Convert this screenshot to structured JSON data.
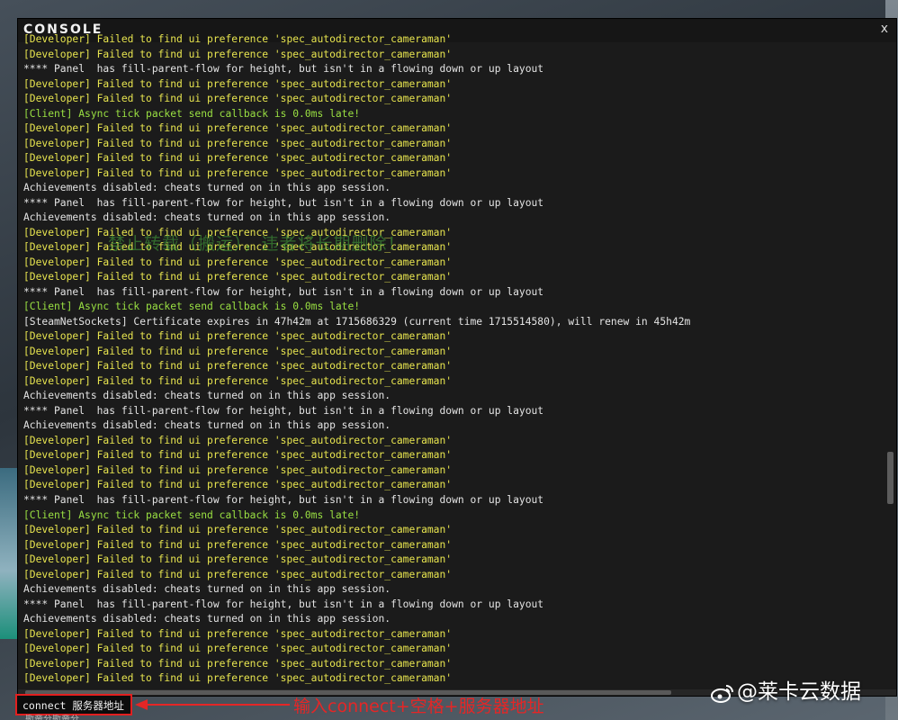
{
  "console": {
    "title": "CONSOLE",
    "close_label": "x",
    "log_lines": [
      {
        "text": "[Developer] Failed to find ui preference 'spec_autodirector_cameraman'",
        "kind": "dev"
      },
      {
        "text": "[Developer] Failed to find ui preference 'spec_autodirector_cameraman'",
        "kind": "dev"
      },
      {
        "text": "**** Panel  has fill-parent-flow for height, but isn't in a flowing down or up layout",
        "kind": "info"
      },
      {
        "text": "[Developer] Failed to find ui preference 'spec_autodirector_cameraman'",
        "kind": "dev"
      },
      {
        "text": "[Developer] Failed to find ui preference 'spec_autodirector_cameraman'",
        "kind": "dev"
      },
      {
        "text": "[Client] Async tick packet send callback is 0.0ms late!",
        "kind": "client"
      },
      {
        "text": "[Developer] Failed to find ui preference 'spec_autodirector_cameraman'",
        "kind": "dev"
      },
      {
        "text": "[Developer] Failed to find ui preference 'spec_autodirector_cameraman'",
        "kind": "dev"
      },
      {
        "text": "[Developer] Failed to find ui preference 'spec_autodirector_cameraman'",
        "kind": "dev"
      },
      {
        "text": "[Developer] Failed to find ui preference 'spec_autodirector_cameraman'",
        "kind": "dev"
      },
      {
        "text": "Achievements disabled: cheats turned on in this app session.",
        "kind": "info"
      },
      {
        "text": "**** Panel  has fill-parent-flow for height, but isn't in a flowing down or up layout",
        "kind": "info"
      },
      {
        "text": "Achievements disabled: cheats turned on in this app session.",
        "kind": "info"
      },
      {
        "text": "[Developer] Failed to find ui preference 'spec_autodirector_cameraman'",
        "kind": "dev"
      },
      {
        "text": "[Developer] Failed to find ui preference 'spec_autodirector_cameraman'",
        "kind": "dev"
      },
      {
        "text": "[Developer] Failed to find ui preference 'spec_autodirector_cameraman'",
        "kind": "dev"
      },
      {
        "text": "[Developer] Failed to find ui preference 'spec_autodirector_cameraman'",
        "kind": "dev"
      },
      {
        "text": "**** Panel  has fill-parent-flow for height, but isn't in a flowing down or up layout",
        "kind": "info"
      },
      {
        "text": "[Client] Async tick packet send callback is 0.0ms late!",
        "kind": "client"
      },
      {
        "text": "[SteamNetSockets] Certificate expires in 47h42m at 1715686329 (current time 1715514580), will renew in 45h42m",
        "kind": "info"
      },
      {
        "text": "[Developer] Failed to find ui preference 'spec_autodirector_cameraman'",
        "kind": "dev"
      },
      {
        "text": "[Developer] Failed to find ui preference 'spec_autodirector_cameraman'",
        "kind": "dev"
      },
      {
        "text": "[Developer] Failed to find ui preference 'spec_autodirector_cameraman'",
        "kind": "dev"
      },
      {
        "text": "[Developer] Failed to find ui preference 'spec_autodirector_cameraman'",
        "kind": "dev"
      },
      {
        "text": "Achievements disabled: cheats turned on in this app session.",
        "kind": "info"
      },
      {
        "text": "**** Panel  has fill-parent-flow for height, but isn't in a flowing down or up layout",
        "kind": "info"
      },
      {
        "text": "Achievements disabled: cheats turned on in this app session.",
        "kind": "info"
      },
      {
        "text": "[Developer] Failed to find ui preference 'spec_autodirector_cameraman'",
        "kind": "dev"
      },
      {
        "text": "[Developer] Failed to find ui preference 'spec_autodirector_cameraman'",
        "kind": "dev"
      },
      {
        "text": "[Developer] Failed to find ui preference 'spec_autodirector_cameraman'",
        "kind": "dev"
      },
      {
        "text": "[Developer] Failed to find ui preference 'spec_autodirector_cameraman'",
        "kind": "dev"
      },
      {
        "text": "**** Panel  has fill-parent-flow for height, but isn't in a flowing down or up layout",
        "kind": "info"
      },
      {
        "text": "[Client] Async tick packet send callback is 0.0ms late!",
        "kind": "client"
      },
      {
        "text": "[Developer] Failed to find ui preference 'spec_autodirector_cameraman'",
        "kind": "dev"
      },
      {
        "text": "[Developer] Failed to find ui preference 'spec_autodirector_cameraman'",
        "kind": "dev"
      },
      {
        "text": "[Developer] Failed to find ui preference 'spec_autodirector_cameraman'",
        "kind": "dev"
      },
      {
        "text": "[Developer] Failed to find ui preference 'spec_autodirector_cameraman'",
        "kind": "dev"
      },
      {
        "text": "Achievements disabled: cheats turned on in this app session.",
        "kind": "info"
      },
      {
        "text": "**** Panel  has fill-parent-flow for height, but isn't in a flowing down or up layout",
        "kind": "info"
      },
      {
        "text": "Achievements disabled: cheats turned on in this app session.",
        "kind": "info"
      },
      {
        "text": "[Developer] Failed to find ui preference 'spec_autodirector_cameraman'",
        "kind": "dev"
      },
      {
        "text": "[Developer] Failed to find ui preference 'spec_autodirector_cameraman'",
        "kind": "dev"
      },
      {
        "text": "[Developer] Failed to find ui preference 'spec_autodirector_cameraman'",
        "kind": "dev"
      },
      {
        "text": "[Developer] Failed to find ui preference 'spec_autodirector_cameraman'",
        "kind": "dev"
      }
    ],
    "watermark": "禁止转载（搬运），违者将长期删除！",
    "input_value": "connect 服务器地址",
    "below_input_text": "斯蒂芬斯蒂芬"
  },
  "annotation": {
    "text": "输入connect+空格+服务器地址",
    "color": "#e52626"
  },
  "logo": {
    "text": "@莱卡云数据",
    "icon": "weibo-icon"
  },
  "colors": {
    "developer_line": "#e8e54f",
    "client_line": "#9ae042",
    "default_line": "#e4e4e4",
    "window_bg": "#1b1b1b"
  }
}
